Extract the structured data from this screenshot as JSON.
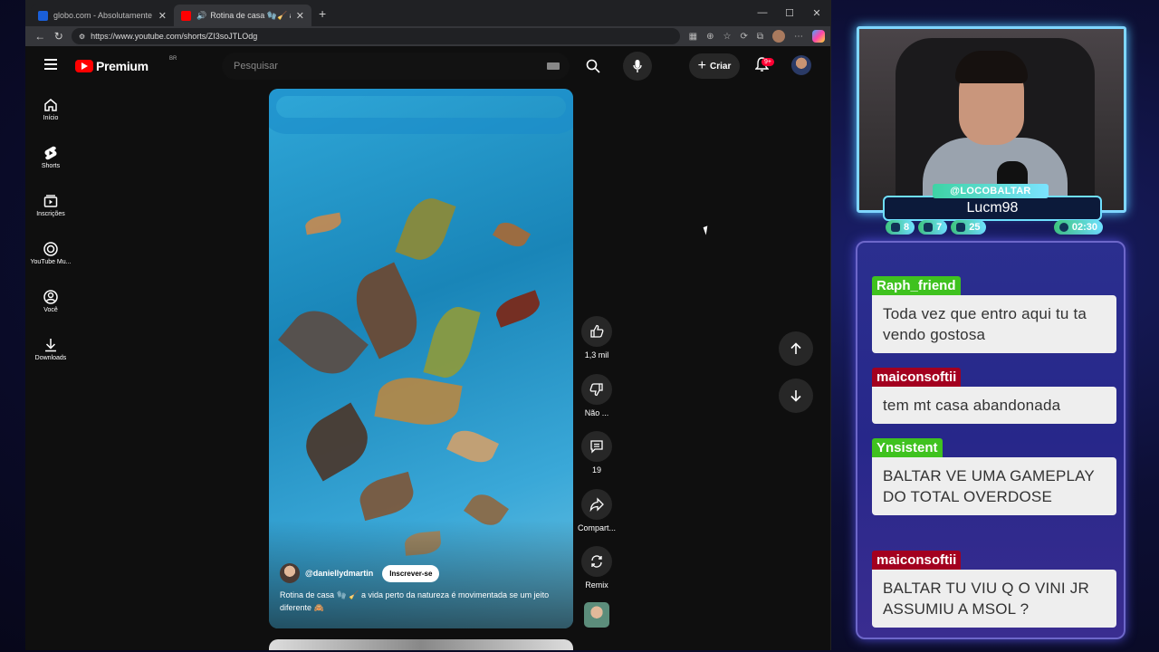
{
  "browser": {
    "tabs": [
      {
        "title": "globo.com - Absolutamente tudo",
        "favicon_color": "#1a5fd8"
      },
      {
        "title": "Rotina de casa 🧤🧹 a vida",
        "favicon_color": "#ff0000"
      }
    ],
    "url": "https://www.youtube.com/shorts/ZI3soJTLOdg",
    "window_controls": [
      "—",
      "☐",
      "✕"
    ]
  },
  "youtube": {
    "logo_text": "Premium",
    "logo_region": "BR",
    "search_placeholder": "Pesquisar",
    "create_label": "Criar",
    "notification_count": "9+",
    "sidebar": [
      {
        "label": "Início",
        "icon": "home-icon"
      },
      {
        "label": "Shorts",
        "icon": "shorts-icon"
      },
      {
        "label": "Inscrições",
        "icon": "subscriptions-icon"
      },
      {
        "label": "YouTube Mu...",
        "icon": "youtube-music-icon"
      },
      {
        "label": "Você",
        "icon": "you-icon"
      },
      {
        "label": "Downloads",
        "icon": "download-icon"
      }
    ],
    "short": {
      "channel": "@daniellydmartin",
      "subscribe_label": "Inscrever-se",
      "description": "Rotina de casa 🧤 🧹 a vida perto da natureza é movimentada se um jeito diferente 🙈"
    },
    "actions": [
      {
        "label": "1,3 mil",
        "icon": "like-icon"
      },
      {
        "label": "Não ...",
        "icon": "dislike-icon"
      },
      {
        "label": "19",
        "icon": "comments-icon"
      },
      {
        "label": "Compart...",
        "icon": "share-icon"
      },
      {
        "label": "Remix",
        "icon": "remix-icon"
      }
    ]
  },
  "stream": {
    "handle": "@LOCOBALTAR",
    "name": "Lucm98",
    "stats": [
      {
        "value": "8",
        "icon": "twitch-icon"
      },
      {
        "value": "7",
        "icon": "youtube-icon"
      },
      {
        "value": "25",
        "icon": "kick-icon"
      },
      {
        "value": "02:30",
        "icon": "clock-icon"
      }
    ]
  },
  "chat": [
    {
      "user": "Raph_friend",
      "color": "#3fc21f",
      "text": "Toda vez que entro aqui tu ta vendo gostosa"
    },
    {
      "user": "maiconsoftii",
      "color": "#a3001f",
      "text": "tem mt casa abandonada"
    },
    {
      "user": "Ynsistent",
      "color": "#3fc21f",
      "text": "BALTAR VE UMA GAMEPLAY DO TOTAL OVERDOSE"
    },
    {
      "user": "maiconsoftii",
      "color": "#a3001f",
      "text": "BALTAR TU VIU Q O VINI JR ASSUMIU A MSOL ?"
    }
  ]
}
